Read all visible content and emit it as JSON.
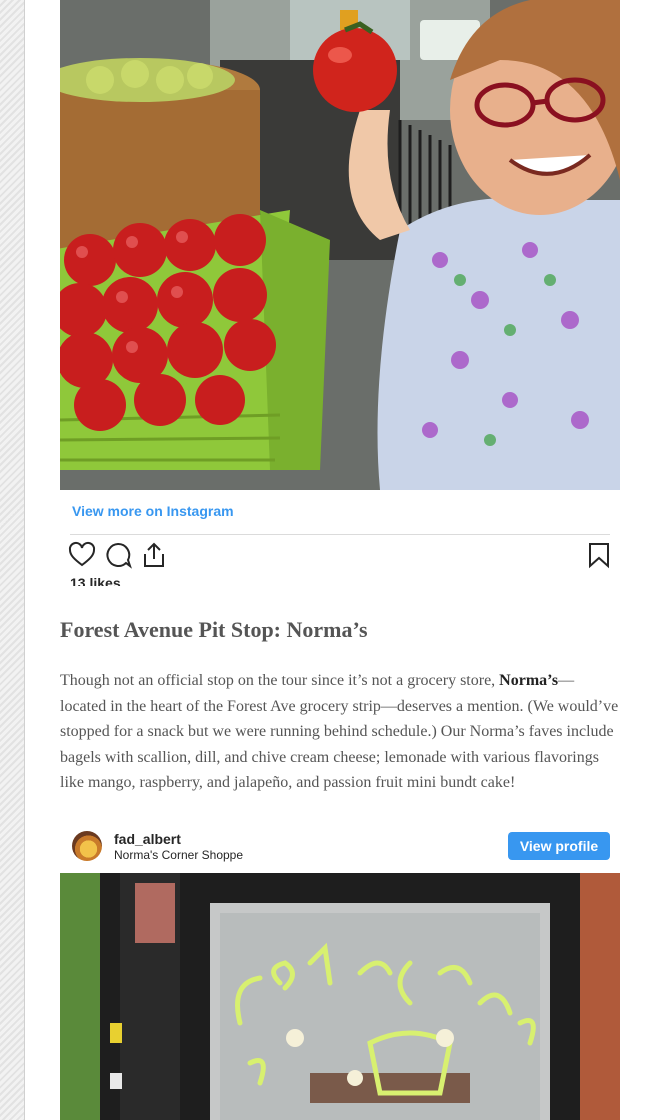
{
  "post1": {
    "view_more_label": "View more on Instagram",
    "likes": "13 likes",
    "actions": [
      "heart-icon",
      "comment-icon",
      "share-icon",
      "bookmark-icon"
    ]
  },
  "article": {
    "heading": "Forest Avenue Pit Stop: Norma’s",
    "paragraph_before": "Though not an official stop on the tour since it’s not a grocery store, ",
    "paragraph_bold": "Norma’s",
    "paragraph_after": "—located in the heart of the Forest Ave grocery strip—deserves a mention. (We would’ve stopped for a snack but we were running behind schedule.) Our Norma’s faves include bagels with scallion, dill, and chive cream cheese; lemonade with various flavorings like mango, raspberry, and jalapeño, and passion fruit mini bundt cake!"
  },
  "post2": {
    "username": "fad_albert",
    "location": "Norma's Corner Shoppe",
    "view_profile_label": "View profile"
  },
  "colors": {
    "accent": "#3897f0",
    "text": "#555555",
    "heading": "#555555"
  }
}
